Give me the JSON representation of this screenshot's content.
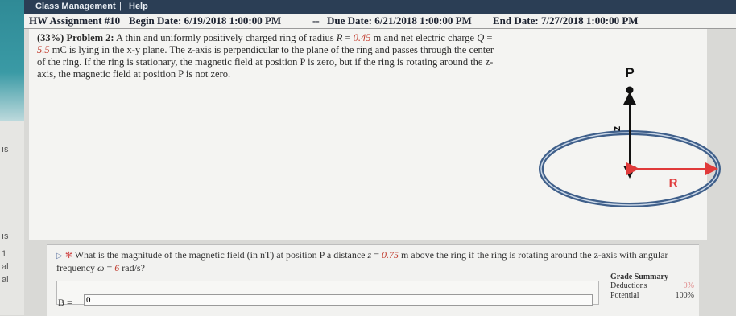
{
  "topbar": {
    "class_management": "Class Management",
    "separator": "|",
    "help": "Help"
  },
  "header": {
    "assignment": "HW Assignment #10",
    "begin": "Begin Date: 6/19/2018 1:00:00 PM",
    "dash": "--",
    "due": "Due Date: 6/21/2018 1:00:00 PM",
    "end": "End Date: 7/27/2018 1:00:00 PM"
  },
  "left_strip": {
    "frag1": "ıs",
    "frag2": "ıs",
    "frag3": "1",
    "frag4": "al",
    "frag5": "al"
  },
  "problem": {
    "percent": "(33%)",
    "number": "Problem 2:",
    "t1": "A thin and uniformly positively charged ring of radius",
    "R_sym": "R",
    "eq": "=",
    "R_val": "0.45",
    "t2": "m and net electric charge",
    "Q_sym": "Q",
    "Q_val": "5.5",
    "t3": "mC is lying in the x-y plane. The z-axis is perpendicular to the plane of the ring and passes through the center of the ring. If the ring is stationary, the magnetic field at position P is zero, but if the ring is rotating around the z-axis, the magnetic field at position P is not zero."
  },
  "figure": {
    "P": "P",
    "z": "z",
    "R": "R"
  },
  "question": {
    "text1": "What is the magnitude of the magnetic field (in nT) at position P a distance",
    "z_sym": "z",
    "eq": "=",
    "z_val": "0.75",
    "text2": "m above the ring if the ring is rotating around the z-axis with angular frequency",
    "omega": "ω",
    "omega_val": "6",
    "text3": "rad/s?"
  },
  "answer": {
    "label": "B =",
    "value": "0"
  },
  "grade": {
    "title": "Grade Summary",
    "deductions_label": "Deductions",
    "deductions_value": "0%",
    "potential_label": "Potential",
    "potential_value": "100%"
  },
  "colors": {
    "topbar": "#2b3e55",
    "highlight": "#c0392b",
    "ring": "#3f5f8a",
    "arrow": "#e03a3a"
  }
}
